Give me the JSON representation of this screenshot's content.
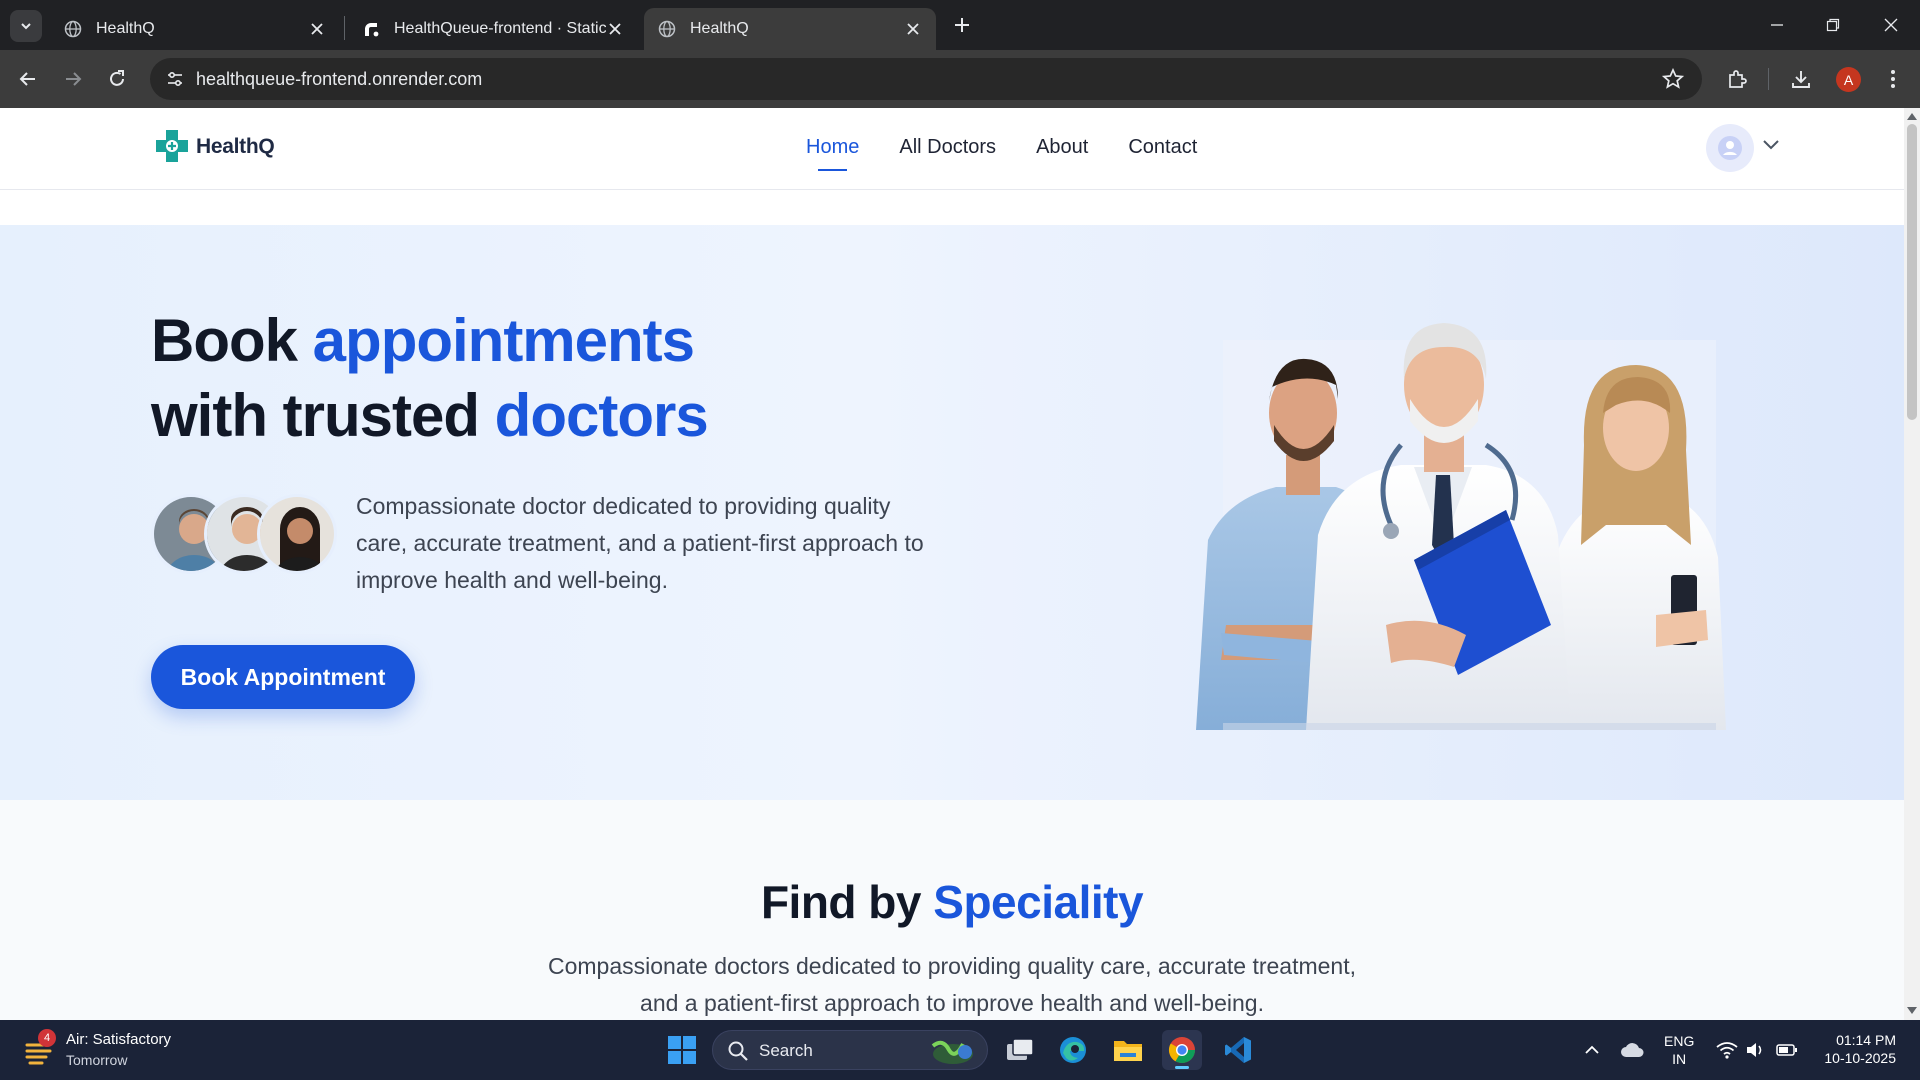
{
  "browser": {
    "tabs": [
      {
        "title": "HealthQ",
        "active": false
      },
      {
        "title": "HealthQueue-frontend · Static",
        "active": false
      },
      {
        "title": "HealthQ",
        "active": true
      }
    ],
    "url": "healthqueue-frontend.onrender.com",
    "profile_initial": "A"
  },
  "site": {
    "logo_text": "HealthQ",
    "nav": [
      "Home",
      "All Doctors",
      "About",
      "Contact"
    ],
    "active_nav": "Home"
  },
  "hero": {
    "title_line1_dark": "Book ",
    "title_line1_blue": "appointments",
    "title_line2_dark": "with trusted ",
    "title_line2_blue": "doctors",
    "description": "Compassionate doctor dedicated to providing quality care, accurate treatment, and a patient-first approach to improve health and well-being.",
    "cta": "Book Appointment"
  },
  "speciality": {
    "title_dark": "Find by ",
    "title_blue": "Speciality",
    "description": "Compassionate doctors dedicated to providing quality care, accurate treatment, and a patient-first approach to improve health and well-being."
  },
  "taskbar": {
    "weather_title": "Air: Satisfactory",
    "weather_sub": "Tomorrow",
    "weather_badge": "4",
    "search_label": "Search",
    "lang_top": "ENG",
    "lang_bottom": "IN",
    "time": "01:14 PM",
    "date": "10-10-2025"
  },
  "colors": {
    "brand_blue": "#1a56db",
    "logo_teal": "#1aa39a",
    "hero_bg": "#e6f0fd",
    "taskbar_bg": "#1b2338"
  }
}
